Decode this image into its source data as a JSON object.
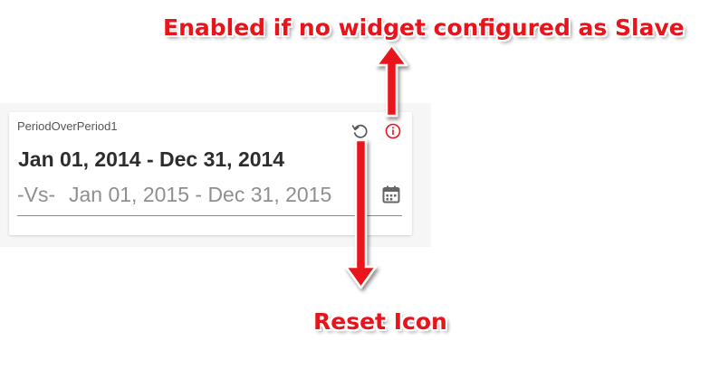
{
  "widget": {
    "title": "PeriodOverPeriod1",
    "primary_range": "Jan 01, 2014 - Dec 31, 2014",
    "compare_prefix": "-Vs-",
    "compare_range": "Jan 01, 2015 - Dec 31, 2015",
    "icons": {
      "reset": "reset-icon",
      "info": "info-icon",
      "calendar": "calendar-icon"
    }
  },
  "annotations": {
    "top": "Enabled if no widget configured as Slave",
    "bottom": "Reset Icon"
  },
  "colors": {
    "annotation_red": "#e8141c",
    "panel_background": "#f6f6f6",
    "card_background": "#ffffff",
    "title_text": "#555555",
    "primary_text": "#2d2d2d",
    "secondary_text": "#8f8f8f"
  }
}
